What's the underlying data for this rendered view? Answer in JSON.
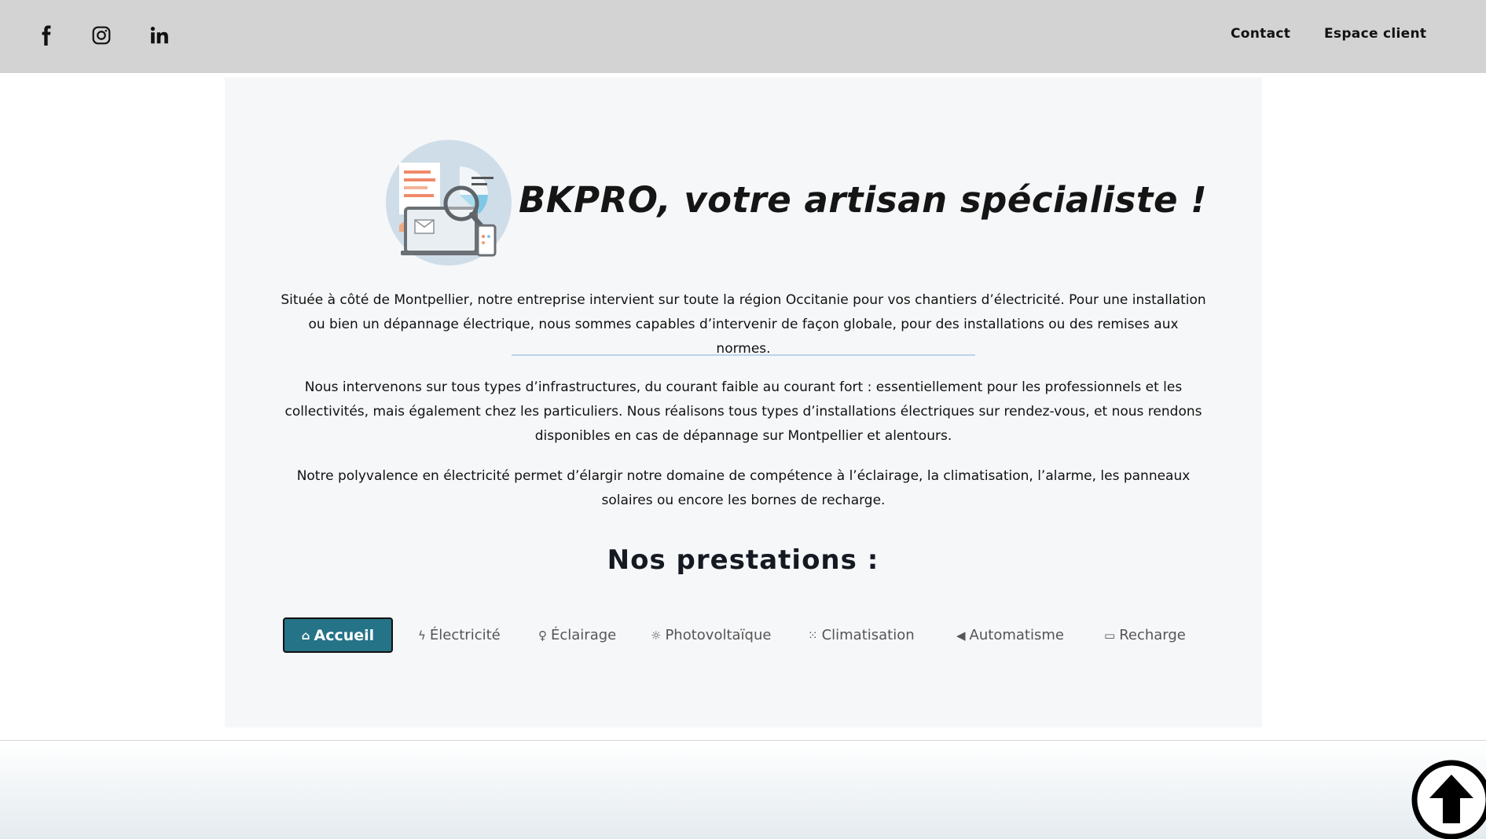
{
  "header": {
    "social": [
      {
        "icon": "facebook-icon"
      },
      {
        "icon": "instagram-icon"
      },
      {
        "icon": "linkedin-icon"
      }
    ],
    "nav": {
      "contact": "Contact",
      "espace_client": "Espace client"
    }
  },
  "hero": {
    "image_icon": "analytics-illustration",
    "title": "BKPRO, votre artisan spécialiste !"
  },
  "content": {
    "intro": "Située à côté de Montpellier, notre entreprise intervient sur toute la région Occitanie pour vos chantiers d’électricité. Pour une installation ou bien un dépannage électrique, nous sommes capables d’intervenir de façon globale, pour des installations ou des remises aux normes.",
    "para2": "Nous intervenons sur tous types d’infrastructures, du courant faible au courant fort : essentiellement pour les professionnels et les collectivités, mais également chez les particuliers. Nous réalisons tous types d’installations électriques sur rendez-vous, et nous rendons disponibles en cas de dépannage sur Montpellier et alentours.",
    "para3": "Notre polyvalence en électricité permet d’élargir notre domaine de compétence à l’éclairage, la climatisation, l’alarme, les panneaux solaires ou encore les bornes de recharge."
  },
  "services": {
    "title": "Nos prestations :",
    "tabs": [
      {
        "label": "Accueil",
        "icon": "home-icon",
        "glyph": "⌂",
        "active": true
      },
      {
        "label": "Électricité",
        "icon": "bolt-icon",
        "glyph": "ϟ"
      },
      {
        "label": "Éclairage",
        "icon": "lightbulb-icon",
        "glyph": "♀"
      },
      {
        "label": "Photovoltaïque",
        "icon": "sun-icon",
        "glyph": "☼"
      },
      {
        "label": "Climatisation",
        "icon": "grid-icon",
        "glyph": "⁙"
      },
      {
        "label": "Automatisme",
        "icon": "megaphone-icon",
        "glyph": "◀"
      },
      {
        "label": "Recharge",
        "icon": "battery-icon",
        "glyph": "▭"
      }
    ]
  },
  "colors": {
    "header_bg": "#d3d3d3",
    "panel_bg": "#f6f7f9",
    "active_tab": "#257387",
    "divider": "#bcd3ee"
  },
  "scroll_top": {
    "icon": "arrow-up-circle-icon"
  }
}
